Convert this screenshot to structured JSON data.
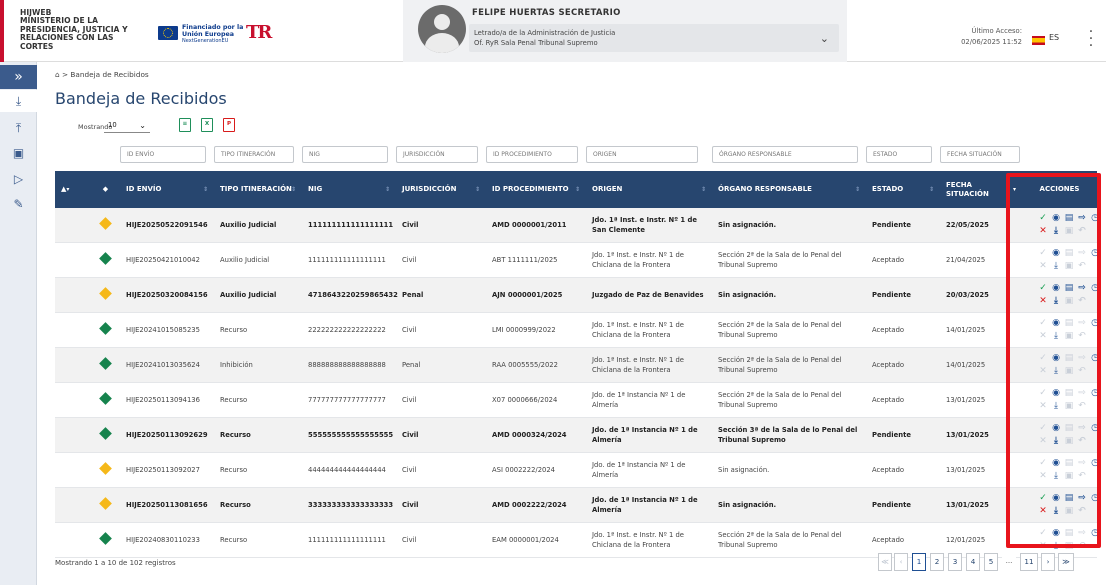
{
  "header": {
    "app_code": "HIJWEB",
    "org_name": "MINISTERIO DE LA PRESIDENCIA, JUSTICIA Y RELACIONES CON LAS CORTES",
    "eu_logo_title": "Financiado por la Unión Europea",
    "eu_logo_sub": "NextGenerationEU",
    "tr_logo": "TR",
    "user_name": "FELIPE HUERTAS SECRETARIO",
    "user_role_line1": "Letrado/a de la Administración de Justicia",
    "user_role_line2": "Of. RyR Sala Penal Tribunal Supremo",
    "last_access_label": "Último Acceso:",
    "last_access_value": "02/06/2025 11:52",
    "language": "ES",
    "icons": {
      "avatar": "user-avatar-icon",
      "dropdown": "chevron-down-icon",
      "menu": "kebab-menu-icon",
      "flag": "spain-flag-icon"
    }
  },
  "sidebar": {
    "items": [
      {
        "name": "expand-icon",
        "glyph": "≫"
      },
      {
        "name": "inbox-received-icon",
        "glyph": "⤓"
      },
      {
        "name": "outbox-sent-icon",
        "glyph": "⤒"
      },
      {
        "name": "document-search-icon",
        "glyph": "🗎"
      },
      {
        "name": "forward-icon",
        "glyph": "▷"
      },
      {
        "name": "document-edit-icon",
        "glyph": "✎"
      }
    ]
  },
  "breadcrumb": {
    "home_icon": "home-icon",
    "current": "Bandeja de Recibidos"
  },
  "page_title": "Bandeja de Recibidos",
  "toolbar": {
    "showing_label": "Mostrando",
    "page_size": "10",
    "export_icons": [
      "csv-export-icon",
      "excel-export-icon",
      "pdf-export-icon"
    ]
  },
  "filters": {
    "id_envio": "ID ENVÍO",
    "tipo_itineracion": "TIPO ITINERACIÓN",
    "nig": "NIG",
    "jurisdiccion": "JURISDICCIÓN",
    "id_procedimiento": "ID PROCEDIMIENTO",
    "origen": "ORIGEN",
    "organo_responsable": "ÓRGANO RESPONSABLE",
    "estado": "ESTADO",
    "fecha_situacion": "FECHA SITUACIÓN"
  },
  "table": {
    "headers": {
      "id_envio": "ID ENVÍO",
      "tipo_itineracion": "TIPO ITINERACIÓN",
      "nig": "NIG",
      "jurisdiccion": "JURISDICCIÓN",
      "id_procedimiento": "ID PROCEDIMIENTO",
      "origen": "ORIGEN",
      "organo_responsable": "ÓRGANO RESPONSABLE",
      "estado": "ESTADO",
      "fecha_situacion": "FECHA SITUACIÓN",
      "acciones": "ACCIONES"
    },
    "rows": [
      {
        "bold": true,
        "marker": "yellow",
        "id_envio": "HIJE20250522091546",
        "tipo": "Auxilio Judicial",
        "nig": "111111111111111111",
        "juris": "Civil",
        "proc": "AMD 0000001/2011",
        "origen": "Jdo. 1ª Inst. e Instr. Nº 1 de San Clemente",
        "organo": "Sin asignación.",
        "estado": "Pendiente",
        "fecha": "22/05/2025",
        "pending": true
      },
      {
        "bold": false,
        "marker": "green",
        "id_envio": "HIJE20250421010042",
        "tipo": "Auxilio Judicial",
        "nig": "111111111111111111",
        "juris": "Civil",
        "proc": "ABT 1111111/2025",
        "origen": "Jdo. 1ª Inst. e Instr. Nº 1 de Chiclana de la Frontera",
        "organo": "Sección 2ª de la Sala de lo Penal del Tribunal Supremo",
        "estado": "Aceptado",
        "fecha": "21/04/2025",
        "pending": false
      },
      {
        "bold": true,
        "marker": "yellow",
        "id_envio": "HIJE20250320084156",
        "tipo": "Auxilio Judicial",
        "nig": "4718643220259865432",
        "juris": "Penal",
        "proc": "AJN 0000001/2025",
        "origen": "Juzgado de Paz de Benavides",
        "organo": "Sin asignación.",
        "estado": "Pendiente",
        "fecha": "20/03/2025",
        "pending": true
      },
      {
        "bold": false,
        "marker": "green",
        "id_envio": "HIJE20241015085235",
        "tipo": "Recurso",
        "nig": "222222222222222222",
        "juris": "Civil",
        "proc": "LMI 0000999/2022",
        "origen": "Jdo. 1ª Inst. e Instr. Nº 1 de Chiclana de la Frontera",
        "organo": "Sección 2ª de la Sala de lo Penal del Tribunal Supremo",
        "estado": "Aceptado",
        "fecha": "14/01/2025",
        "pending": false
      },
      {
        "bold": false,
        "marker": "green",
        "id_envio": "HIJE20241013035624",
        "tipo": "Inhibición",
        "nig": "888888888888888888",
        "juris": "Penal",
        "proc": "RAA 0005555/2022",
        "origen": "Jdo. 1ª Inst. e Instr. Nº 1 de Chiclana de la Frontera",
        "organo": "Sección 2ª de la Sala de lo Penal del Tribunal Supremo",
        "estado": "Aceptado",
        "fecha": "14/01/2025",
        "pending": false
      },
      {
        "bold": false,
        "marker": "green",
        "id_envio": "HIJE20250113094136",
        "tipo": "Recurso",
        "nig": "777777777777777777",
        "juris": "Civil",
        "proc": "X07 0000666/2024",
        "origen": "Jdo. de 1ª Instancia Nº 1 de Almería",
        "organo": "Sección 2ª de la Sala de lo Penal del Tribunal Supremo",
        "estado": "Aceptado",
        "fecha": "13/01/2025",
        "pending": false
      },
      {
        "bold": true,
        "marker": "green",
        "id_envio": "HIJE20250113092629",
        "tipo": "Recurso",
        "nig": "555555555555555555",
        "juris": "Civil",
        "proc": "AMD 0000324/2024",
        "origen": "Jdo. de 1ª Instancia Nº 1 de Almería",
        "organo": "Sección 3ª de la Sala de lo Penal del Tribunal Supremo",
        "estado": "Pendiente",
        "fecha": "13/01/2025",
        "pending": false
      },
      {
        "bold": false,
        "marker": "yellow",
        "id_envio": "HIJE20250113092027",
        "tipo": "Recurso",
        "nig": "444444444444444444",
        "juris": "Civil",
        "proc": "ASI 0002222/2024",
        "origen": "Jdo. de 1ª Instancia Nº 1 de Almería",
        "organo": "Sin asignación.",
        "estado": "Aceptado",
        "fecha": "13/01/2025",
        "pending": false
      },
      {
        "bold": true,
        "marker": "yellow",
        "id_envio": "HIJE20250113081656",
        "tipo": "Recurso",
        "nig": "333333333333333333",
        "juris": "Civil",
        "proc": "AMD 0002222/2024",
        "origen": "Jdo. de 1ª Instancia Nº 1 de Almería",
        "organo": "Sin asignación.",
        "estado": "Pendiente",
        "fecha": "13/01/2025",
        "pending": true
      },
      {
        "bold": false,
        "marker": "green",
        "id_envio": "HIJE20240830110233",
        "tipo": "Recurso",
        "nig": "111111111111111111",
        "juris": "Civil",
        "proc": "EAM 0000001/2024",
        "origen": "Jdo. 1ª Inst. e Instr. Nº 1 de Chiclana de la Frontera",
        "organo": "Sección 2ª de la Sala de lo Penal del Tribunal Supremo",
        "estado": "Aceptado",
        "fecha": "12/01/2025",
        "pending": false
      }
    ],
    "action_icons": [
      "accept-check-icon",
      "view-eye-icon",
      "document-icon",
      "export-document-icon",
      "history-clock-icon",
      "reject-x-icon",
      "download-icon",
      "copy-document-icon",
      "reply-arrow-icon"
    ]
  },
  "footer": {
    "info": "Mostrando 1 a 10 de 102 registros",
    "pages": [
      "1",
      "2",
      "3",
      "4",
      "5",
      "...",
      "11"
    ],
    "current_page": "1",
    "nav": {
      "first": "≪",
      "prev": "‹",
      "next": "›",
      "last": "≫"
    }
  },
  "colors": {
    "primary": "#27466f",
    "accent_red": "#e8141c",
    "pending_yellow": "#f5b819",
    "accepted_green": "#16834d"
  }
}
